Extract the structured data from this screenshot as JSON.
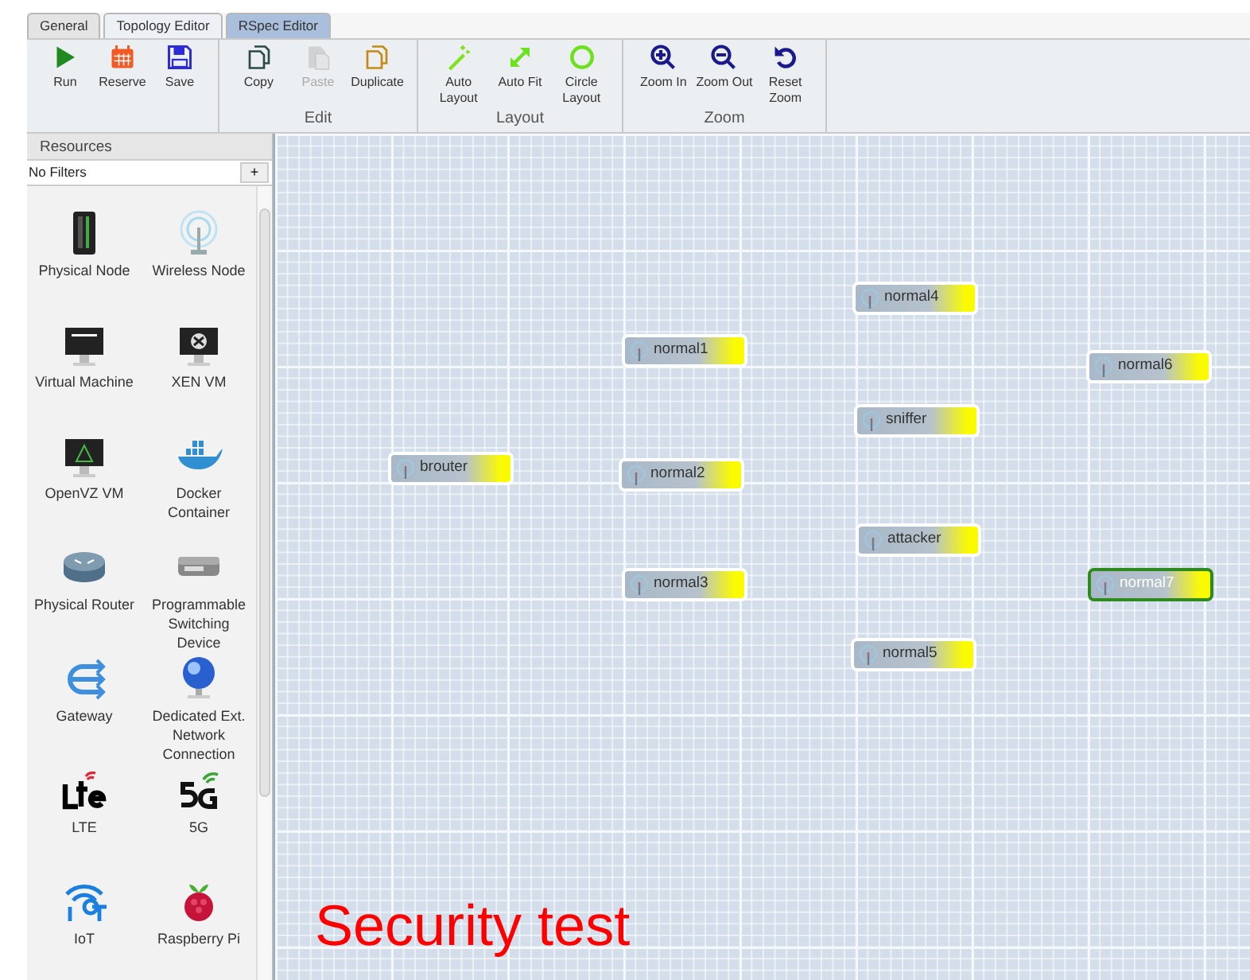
{
  "tabs": [
    {
      "label": "General",
      "selected": false
    },
    {
      "label": "Topology Editor",
      "selected": true
    },
    {
      "label": "RSpec Editor",
      "selected": false
    }
  ],
  "toolbar": {
    "groups": [
      {
        "buttons": [
          {
            "label": "Run",
            "disabled": false
          },
          {
            "label": "Reserve",
            "disabled": false
          },
          {
            "label": "Save",
            "disabled": false
          }
        ]
      },
      {
        "label": "Edit",
        "buttons": [
          {
            "label": "Copy",
            "disabled": false
          },
          {
            "label": "Paste",
            "disabled": true
          },
          {
            "label": "Duplicate",
            "disabled": false
          }
        ]
      },
      {
        "label": "Layout",
        "buttons": [
          {
            "label": "Auto Layout",
            "disabled": false
          },
          {
            "label": "Auto Fit",
            "disabled": false
          },
          {
            "label": "Circle Layout",
            "disabled": false
          }
        ]
      },
      {
        "label": "Zoom",
        "buttons": [
          {
            "label": "Zoom In",
            "disabled": false
          },
          {
            "label": "Zoom Out",
            "disabled": false
          },
          {
            "label": "Reset Zoom",
            "disabled": false
          }
        ]
      }
    ]
  },
  "sidebar": {
    "title": "Resources",
    "filter": "No Filters",
    "filter_button": "+",
    "items": [
      {
        "label": "Physical Node"
      },
      {
        "label": "Wireless Node"
      },
      {
        "label": "Virtual Machine"
      },
      {
        "label": "XEN VM"
      },
      {
        "label": "OpenVZ VM"
      },
      {
        "label": "Docker Container"
      },
      {
        "label": "Physical Router"
      },
      {
        "label": "Programmable Switching Device"
      },
      {
        "label": "Gateway"
      },
      {
        "label": "Dedicated Ext. Network Connection"
      },
      {
        "label": "LTE"
      },
      {
        "label": "5G"
      },
      {
        "label": "IoT"
      },
      {
        "label": "Raspberry Pi"
      }
    ]
  },
  "canvas": {
    "nodes": [
      {
        "label": "normal4",
        "selected": false
      },
      {
        "label": "normal1",
        "selected": false
      },
      {
        "label": "normal6",
        "selected": false
      },
      {
        "label": "sniffer",
        "selected": false
      },
      {
        "label": "brouter",
        "selected": false
      },
      {
        "label": "normal2",
        "selected": false
      },
      {
        "label": "attacker",
        "selected": false
      },
      {
        "label": "normal3",
        "selected": false
      },
      {
        "label": "normal7",
        "selected": true
      },
      {
        "label": "normal5",
        "selected": false
      }
    ],
    "caption": "Security test"
  }
}
